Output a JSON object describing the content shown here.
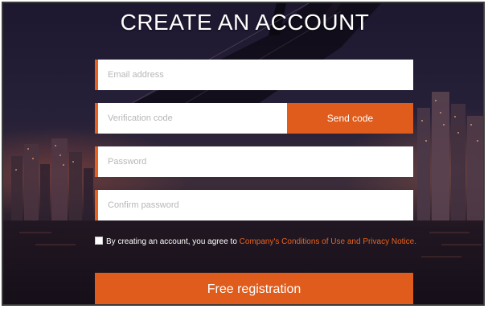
{
  "form": {
    "title": "CREATE AN ACCOUNT",
    "email_placeholder": "Email address",
    "code_placeholder": "Verification code",
    "send_code_label": "Send code",
    "password_placeholder": "Password",
    "confirm_placeholder": "Confirm password",
    "agree_text": "By creating an account, you agree to",
    "terms_link": "Company's Conditions of Use and Privacy Notice.",
    "submit_label": "Free registration"
  },
  "colors": {
    "accent": "#e05c1c",
    "field_bg": "#ffffff",
    "title_text": "#ffffff",
    "background": "#262038"
  },
  "icons": {
    "checkbox": "empty-checkbox"
  }
}
